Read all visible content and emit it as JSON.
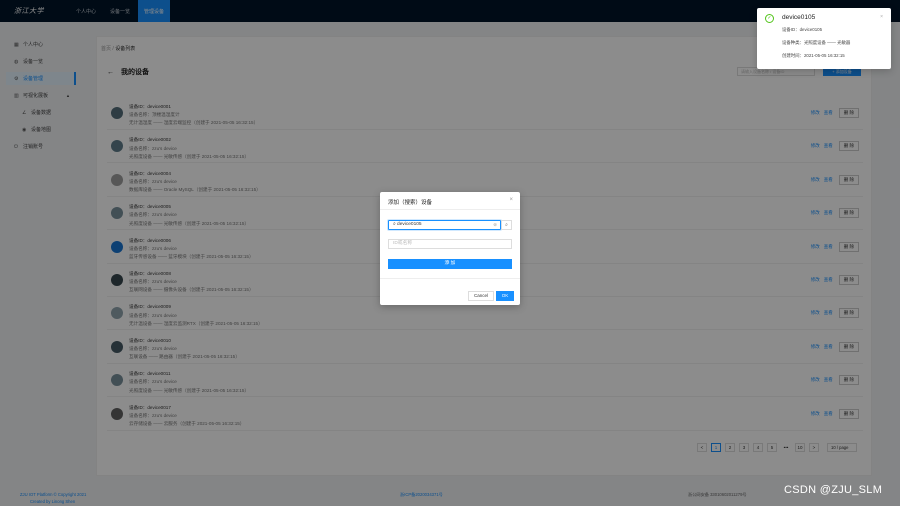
{
  "topnav": {
    "logo": "浙江大学",
    "items": [
      {
        "label": "个人中心"
      },
      {
        "label": "设备一览"
      },
      {
        "label": "管理设备"
      }
    ]
  },
  "sidebar": {
    "items": [
      {
        "label": "个人中心",
        "icon": "grid-icon"
      },
      {
        "label": "设备一览",
        "icon": "globe-icon"
      },
      {
        "label": "设备管理",
        "icon": "settings-icon"
      },
      {
        "label": "可视化展板",
        "icon": "chart-icon"
      },
      {
        "label": "设备数据",
        "icon": "line-chart-icon"
      },
      {
        "label": "设备地图",
        "icon": "map-pin-icon"
      },
      {
        "label": "注销账号",
        "icon": "logout-icon"
      }
    ]
  },
  "breadcrumb": {
    "root": "首页",
    "sep": "/",
    "current": "设备列表"
  },
  "page": {
    "title": "我的设备",
    "search_placeholder": "请输入设备名称 / 设备ID",
    "add_label": "+ 添加设备"
  },
  "devices": [
    {
      "id": "设备ID：device0001",
      "name": "设备名称：顶楼温湿度计",
      "desc": "无计温湿度 —— 湿度云端监控（创建于 2021-05-05 16:32:15）"
    },
    {
      "id": "设备ID：device0002",
      "name": "设备名称：zzu's device",
      "desc": "光照度设备 —— 光敏传感（创建于 2021-05-05 16:32:15）"
    },
    {
      "id": "设备ID：device0004",
      "name": "设备名称：zzu's device",
      "desc": "数据库设备 —— Oracle MySQL（创建于 2021-05-05 16:32:15）"
    },
    {
      "id": "设备ID：device0005",
      "name": "设备名称：zzu's device",
      "desc": "光照度设备 —— 光敏传感（创建于 2021-05-05 16:32:15）"
    },
    {
      "id": "设备ID：device0006",
      "name": "设备名称：zzu's device",
      "desc": "蓝牙传感设备 —— 蓝牙模块（创建于 2021-05-05 16:32:15）"
    },
    {
      "id": "设备ID：device0008",
      "name": "设备名称：zzu's device",
      "desc": "互联网设备 —— 摄像头设备（创建于 2021-05-05 16:32:15）"
    },
    {
      "id": "设备ID：device0009",
      "name": "设备名称：zzu's device",
      "desc": "无计温设备 —— 湿度云监测RTX（创建于 2021-05-05 16:32:15）"
    },
    {
      "id": "设备ID：device0010",
      "name": "设备名称：zzu's device",
      "desc": "互联设备 —— 路由器（创建于 2021-05-05 16:32:15）"
    },
    {
      "id": "设备ID：device0011",
      "name": "设备名称：zzu's device",
      "desc": "光照度设备 —— 光敏传感（创建于 2021-05-05 16:32:15）"
    },
    {
      "id": "设备ID：device0017",
      "name": "设备名称：zzu's device",
      "desc": "云存储设备 —— 云服务（创建于 2021-05-05 16:32:15）"
    }
  ],
  "device_actions": {
    "edit": "修改",
    "view": "查看",
    "delete": "删 除"
  },
  "pagination": {
    "prev": "<",
    "pages": [
      "1",
      "2",
      "3",
      "4",
      "5"
    ],
    "ellipsis": "•••",
    "last": "10",
    "next": ">",
    "page_size": "10 / page"
  },
  "footer": {
    "line1": "ZJU IOT Platform © Copyright 2021",
    "line2": "Created by Linong Shen",
    "icp": "浙ICP备2020034371号",
    "police": "浙公网安备 33010602011279号"
  },
  "watermark": "CSDN @ZJU_SLM",
  "modal": {
    "title": "添加（搜索）设备",
    "search_value": "device0105",
    "input_placeholder": "ID或名称",
    "add_button": "添 加",
    "cancel": "Cancel",
    "ok": "OK"
  },
  "notification": {
    "title": "device0105",
    "line1": "设备ID：device0105",
    "line2": "设备种类：光照度设备 —— 光敏器",
    "line3": "创建时间：2021-05-05 16:32:15"
  }
}
